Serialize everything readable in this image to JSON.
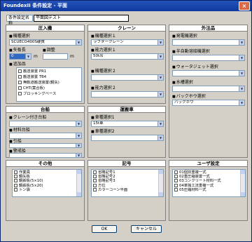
{
  "title": "FoundexII 条件設定 - 平面",
  "close_glyph": "×",
  "condition": {
    "label": "条件設定名称",
    "value": "平面図テスト"
  },
  "panels": {
    "pile": {
      "header": "圧入機",
      "model_label": "機種選択",
      "model_value": "SCUECO400S硬質",
      "length_label": "矢板長",
      "length_value": "0",
      "length_unit": "m",
      "adjust_label": "調整",
      "adjust_unit": "m",
      "accessories_label": "追加品",
      "accessories": [
        "搬送装置 PR1",
        "搬送装置 TB4",
        "無軌道搬送装置(鋼矢)",
        "CHT(案合板)",
        "ブロッキングベース"
      ]
    },
    "crane": {
      "header": "クレーン",
      "model1_label": "機種選択１",
      "model1_value": "ラフタークレーン",
      "capacity1_label": "能力選択１",
      "capacity1_value": "50t吊",
      "model2_label": "機種選択２",
      "model2_value": "",
      "capacity2_label": "能力選択２",
      "capacity2_value": ""
    },
    "external": {
      "header": "外注品",
      "generator_label": "発電機選択",
      "generator_value": "",
      "semi_auto_label": "半自動溶接機選択",
      "semi_auto_value": "",
      "waterjet_label": "ウォータジェット選択",
      "waterjet_value": "",
      "water_tank_label": "水槽選択",
      "water_tank_value": "",
      "backhoe_label": "バックホウ選択",
      "backhoe_value": "バックホウ"
    },
    "platform": {
      "header": "台船",
      "crane_platform_label": "クレーン付き台船",
      "crane_platform_value": "",
      "material_platform_label": "材料台船",
      "material_platform_value": "",
      "tug_label": "引船",
      "tug_value": "",
      "guard_label": "警戒船",
      "guard_value": ""
    },
    "vehicle": {
      "header": "運搬車",
      "type1_label": "車種選択1",
      "type1_value": "15t車",
      "type2_label": "車種選択2",
      "type2_value": ""
    },
    "other": {
      "header": "その他",
      "items": [
        "作業員",
        "鋼矢板",
        "鋼鉄板(5×10)",
        "鋼鉄板(5×20)",
        "トン袋"
      ]
    },
    "symbols": {
      "header": "記号",
      "items": [
        "省略記号1",
        "省略記号2",
        "省略記号3",
        "方位",
        "カラーコーン平面"
      ]
    },
    "user": {
      "header": "ユーザ設定",
      "items": [
        "01個別重複一式",
        "02重圧縮装置一式",
        "03コンクリート材料一式",
        "04単独工法重複一式",
        "05圧縮材料一式"
      ]
    }
  },
  "buttons": {
    "ok": "OK",
    "cancel": "キャンセル"
  }
}
